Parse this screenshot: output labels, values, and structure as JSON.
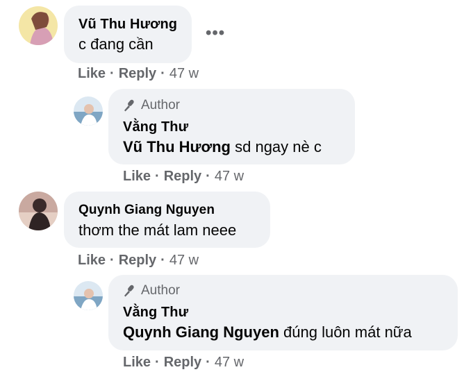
{
  "comments": [
    {
      "name": "Vũ Thu Hương",
      "text": "c đang cần",
      "like": "Like",
      "reply": "Reply",
      "time": "47 w",
      "more": "•••"
    },
    {
      "badge": "Author",
      "name": "Vằng Thư",
      "mention": "Vũ Thu Hương",
      "text": " sd ngay nè c",
      "like": "Like",
      "reply": "Reply",
      "time": "47 w"
    },
    {
      "name": "Quynh Giang Nguyen",
      "text": "thơm the mát lam neee",
      "like": "Like",
      "reply": "Reply",
      "time": "47 w"
    },
    {
      "badge": "Author",
      "name": "Vằng Thư",
      "mention": "Quynh Giang Nguyen",
      "text": " đúng luôn mát nữa",
      "like": "Like",
      "reply": "Reply",
      "time": "47 w"
    }
  ],
  "separator": "·"
}
